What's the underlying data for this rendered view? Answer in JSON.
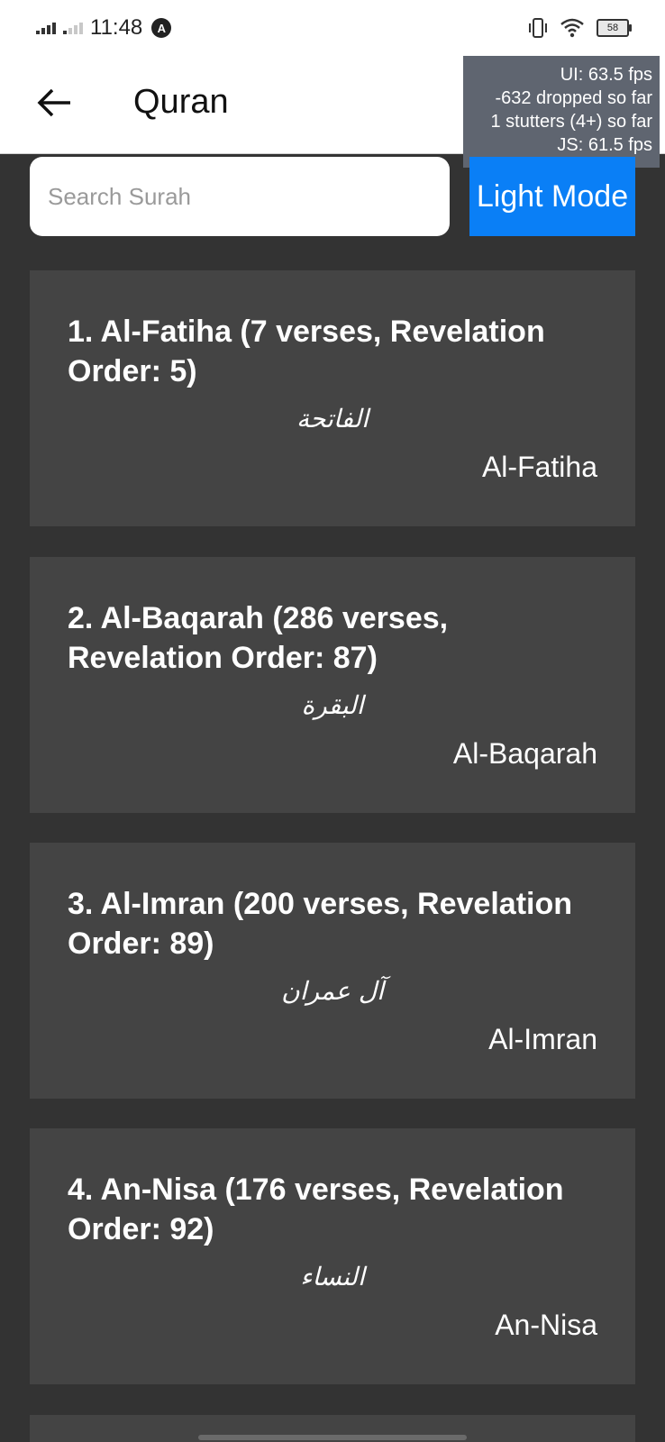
{
  "status_bar": {
    "time": "11:48",
    "nav_badge": "A",
    "battery": "58"
  },
  "header": {
    "title": "Quran"
  },
  "perf": {
    "lines": [
      "UI: 63.5 fps",
      "-632 dropped so far",
      "1 stutters (4+) so far",
      "JS: 61.5 fps"
    ]
  },
  "search": {
    "placeholder": "Search Surah"
  },
  "mode_button": {
    "label": "Light Mode"
  },
  "surahs": [
    {
      "title": "1. Al-Fatiha (7 verses, Revelation Order: 5)",
      "arabic": "الفاتحة",
      "name": "Al-Fatiha"
    },
    {
      "title": "2. Al-Baqarah (286 verses, Revelation Order: 87)",
      "arabic": "البقرة",
      "name": "Al-Baqarah"
    },
    {
      "title": "3. Al-Imran (200 verses, Revelation Order: 89)",
      "arabic": "آل عمران",
      "name": "Al-Imran"
    },
    {
      "title": "4. An-Nisa (176 verses, Revelation Order: 92)",
      "arabic": "النساء",
      "name": "An-Nisa"
    }
  ],
  "colors": {
    "background": "#333333",
    "card": "#444444",
    "accent": "#0a7ff6"
  }
}
